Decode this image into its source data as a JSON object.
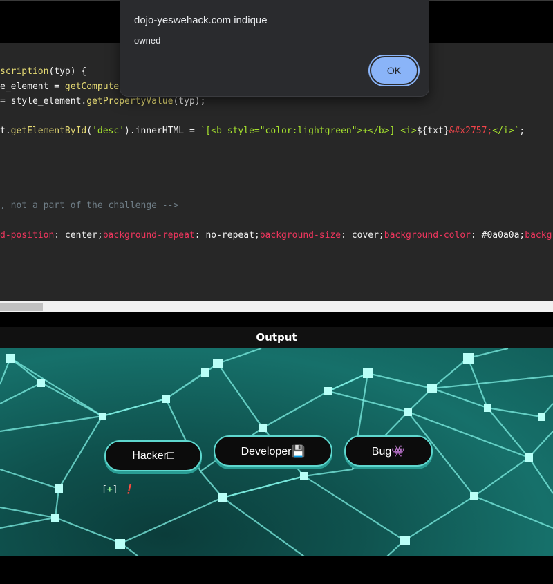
{
  "dialog": {
    "title": "dojo-yeswehack.com indique",
    "message": "owned",
    "ok_label": "OK"
  },
  "code": {
    "lines": [
      [
        {
          "t": "scription",
          "c": "fn"
        },
        {
          "t": "(typ) {",
          "c": "plain"
        }
      ],
      [
        {
          "t": "e_element = ",
          "c": "plain"
        },
        {
          "t": "getCompute",
          "c": "fn"
        }
      ],
      [
        {
          "t": "= style_element.",
          "c": "plain"
        },
        {
          "t": "getPropertyValue",
          "c": "fn"
        },
        {
          "t": "(typ);",
          "c": "plain"
        }
      ],
      [
        {
          "t": "t.",
          "c": "plain"
        },
        {
          "t": "getElementById",
          "c": "fn"
        },
        {
          "t": "(",
          "c": "plain"
        },
        {
          "t": "'desc'",
          "c": "str"
        },
        {
          "t": ").innerHTML = ",
          "c": "plain"
        },
        {
          "t": "`[<b style=\"color:lightgreen\">+</b>] <i>",
          "c": "str"
        },
        {
          "t": "${txt}",
          "c": "plain"
        },
        {
          "t": "&#x2757;",
          "c": "ent"
        },
        {
          "t": "</i>`",
          "c": "str"
        },
        {
          "t": ";",
          "c": "plain"
        }
      ],
      [
        {
          "t": ", not a part of the challenge -->",
          "c": "comment"
        }
      ],
      [
        {
          "t": "d-position",
          "c": "prop"
        },
        {
          "t": ": center;",
          "c": "plain"
        },
        {
          "t": "background-repeat",
          "c": "prop"
        },
        {
          "t": ": no-repeat;",
          "c": "plain"
        },
        {
          "t": "background-size",
          "c": "prop"
        },
        {
          "t": ": cover;",
          "c": "plain"
        },
        {
          "t": "background-color",
          "c": "prop"
        },
        {
          "t": ": #0a0a0a;",
          "c": "plain"
        },
        {
          "t": "backgr",
          "c": "prop"
        }
      ]
    ]
  },
  "output": {
    "title": "Output",
    "buttons": [
      {
        "label": "Hacker□"
      },
      {
        "label": "Developer💾"
      },
      {
        "label": "Bug👾"
      }
    ],
    "desc": {
      "prefix": "[",
      "plus": "+",
      "suffix": "] ",
      "mark": "❗"
    }
  },
  "colors": {
    "editor_bg": "#272727",
    "accent": "#5fd8cf",
    "dialog_ok": "#8ab4f8"
  }
}
